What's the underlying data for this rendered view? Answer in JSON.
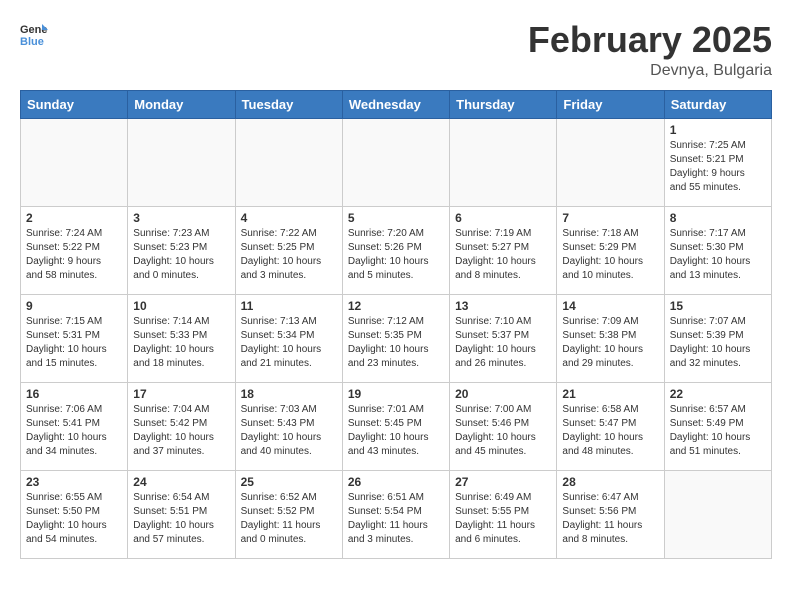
{
  "header": {
    "logo_general": "General",
    "logo_blue": "Blue",
    "month_year": "February 2025",
    "location": "Devnya, Bulgaria"
  },
  "weekdays": [
    "Sunday",
    "Monday",
    "Tuesday",
    "Wednesday",
    "Thursday",
    "Friday",
    "Saturday"
  ],
  "weeks": [
    [
      {
        "day": "",
        "info": "",
        "empty": true
      },
      {
        "day": "",
        "info": "",
        "empty": true
      },
      {
        "day": "",
        "info": "",
        "empty": true
      },
      {
        "day": "",
        "info": "",
        "empty": true
      },
      {
        "day": "",
        "info": "",
        "empty": true
      },
      {
        "day": "",
        "info": "",
        "empty": true
      },
      {
        "day": "1",
        "info": "Sunrise: 7:25 AM\nSunset: 5:21 PM\nDaylight: 9 hours\nand 55 minutes."
      }
    ],
    [
      {
        "day": "2",
        "info": "Sunrise: 7:24 AM\nSunset: 5:22 PM\nDaylight: 9 hours\nand 58 minutes."
      },
      {
        "day": "3",
        "info": "Sunrise: 7:23 AM\nSunset: 5:23 PM\nDaylight: 10 hours\nand 0 minutes."
      },
      {
        "day": "4",
        "info": "Sunrise: 7:22 AM\nSunset: 5:25 PM\nDaylight: 10 hours\nand 3 minutes."
      },
      {
        "day": "5",
        "info": "Sunrise: 7:20 AM\nSunset: 5:26 PM\nDaylight: 10 hours\nand 5 minutes."
      },
      {
        "day": "6",
        "info": "Sunrise: 7:19 AM\nSunset: 5:27 PM\nDaylight: 10 hours\nand 8 minutes."
      },
      {
        "day": "7",
        "info": "Sunrise: 7:18 AM\nSunset: 5:29 PM\nDaylight: 10 hours\nand 10 minutes."
      },
      {
        "day": "8",
        "info": "Sunrise: 7:17 AM\nSunset: 5:30 PM\nDaylight: 10 hours\nand 13 minutes."
      }
    ],
    [
      {
        "day": "9",
        "info": "Sunrise: 7:15 AM\nSunset: 5:31 PM\nDaylight: 10 hours\nand 15 minutes."
      },
      {
        "day": "10",
        "info": "Sunrise: 7:14 AM\nSunset: 5:33 PM\nDaylight: 10 hours\nand 18 minutes."
      },
      {
        "day": "11",
        "info": "Sunrise: 7:13 AM\nSunset: 5:34 PM\nDaylight: 10 hours\nand 21 minutes."
      },
      {
        "day": "12",
        "info": "Sunrise: 7:12 AM\nSunset: 5:35 PM\nDaylight: 10 hours\nand 23 minutes."
      },
      {
        "day": "13",
        "info": "Sunrise: 7:10 AM\nSunset: 5:37 PM\nDaylight: 10 hours\nand 26 minutes."
      },
      {
        "day": "14",
        "info": "Sunrise: 7:09 AM\nSunset: 5:38 PM\nDaylight: 10 hours\nand 29 minutes."
      },
      {
        "day": "15",
        "info": "Sunrise: 7:07 AM\nSunset: 5:39 PM\nDaylight: 10 hours\nand 32 minutes."
      }
    ],
    [
      {
        "day": "16",
        "info": "Sunrise: 7:06 AM\nSunset: 5:41 PM\nDaylight: 10 hours\nand 34 minutes."
      },
      {
        "day": "17",
        "info": "Sunrise: 7:04 AM\nSunset: 5:42 PM\nDaylight: 10 hours\nand 37 minutes."
      },
      {
        "day": "18",
        "info": "Sunrise: 7:03 AM\nSunset: 5:43 PM\nDaylight: 10 hours\nand 40 minutes."
      },
      {
        "day": "19",
        "info": "Sunrise: 7:01 AM\nSunset: 5:45 PM\nDaylight: 10 hours\nand 43 minutes."
      },
      {
        "day": "20",
        "info": "Sunrise: 7:00 AM\nSunset: 5:46 PM\nDaylight: 10 hours\nand 45 minutes."
      },
      {
        "day": "21",
        "info": "Sunrise: 6:58 AM\nSunset: 5:47 PM\nDaylight: 10 hours\nand 48 minutes."
      },
      {
        "day": "22",
        "info": "Sunrise: 6:57 AM\nSunset: 5:49 PM\nDaylight: 10 hours\nand 51 minutes."
      }
    ],
    [
      {
        "day": "23",
        "info": "Sunrise: 6:55 AM\nSunset: 5:50 PM\nDaylight: 10 hours\nand 54 minutes."
      },
      {
        "day": "24",
        "info": "Sunrise: 6:54 AM\nSunset: 5:51 PM\nDaylight: 10 hours\nand 57 minutes."
      },
      {
        "day": "25",
        "info": "Sunrise: 6:52 AM\nSunset: 5:52 PM\nDaylight: 11 hours\nand 0 minutes."
      },
      {
        "day": "26",
        "info": "Sunrise: 6:51 AM\nSunset: 5:54 PM\nDaylight: 11 hours\nand 3 minutes."
      },
      {
        "day": "27",
        "info": "Sunrise: 6:49 AM\nSunset: 5:55 PM\nDaylight: 11 hours\nand 6 minutes."
      },
      {
        "day": "28",
        "info": "Sunrise: 6:47 AM\nSunset: 5:56 PM\nDaylight: 11 hours\nand 8 minutes."
      },
      {
        "day": "",
        "info": "",
        "empty": true
      }
    ]
  ]
}
